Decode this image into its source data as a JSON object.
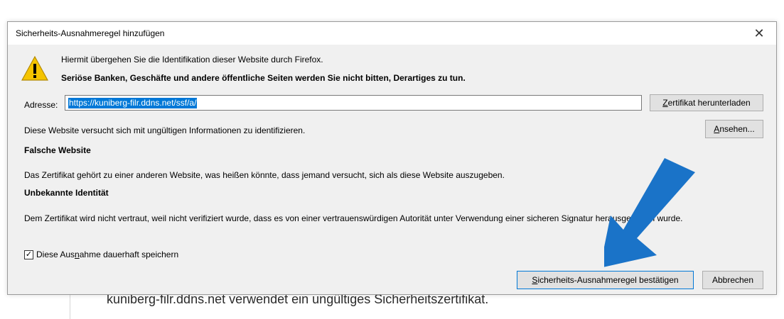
{
  "background": {
    "text": "kuniberg-filr.ddns.net verwendet ein ungültiges Sicherheitszertifikat."
  },
  "dialog": {
    "title": "Sicherheits-Ausnahmeregel hinzufügen",
    "close_glyph": "✕",
    "intro_line": "Hiermit übergehen Sie die Identifikation dieser Website durch Firefox.",
    "warning_line": "Seriöse Banken, Geschäfte und andere öffentliche Seiten werden Sie nicht bitten, Derartiges zu tun.",
    "address_label": "Adresse:",
    "address_value": "https://kuniberg-filr.ddns.net/ssf/a/",
    "download_cert_button": {
      "first": "Z",
      "rest": "ertifikat herunterladen"
    },
    "status_text": "Diese Website versucht sich mit ungültigen Informationen zu identifizieren.",
    "view_button": {
      "first": "A",
      "rest": "nsehen..."
    },
    "section1_title": "Falsche Website",
    "section1_text": "Das Zertifikat gehört zu einer anderen Website, was heißen könnte, dass jemand versucht, sich als diese Website auszugeben.",
    "section2_title": "Unbekannte Identität",
    "section2_text": "Dem Zertifikat wird nicht vertraut, weil nicht verifiziert wurde, dass es von einer vertrauenswürdigen Autorität unter Verwendung einer sicheren Signatur herausgegeben wurde.",
    "permanent_checkbox": {
      "checked": true,
      "check_glyph": "✓",
      "label_pre": "Diese Aus",
      "label_u": "n",
      "label_post": "ahme dauerhaft speichern"
    },
    "confirm_button": {
      "first": "S",
      "rest": "icherheits-Ausnahmeregel bestätigen"
    },
    "cancel_button": "Abbrechen"
  },
  "colors": {
    "dialog_bg": "#f0f0f0",
    "selection": "#0078d7",
    "arrow": "#1a73c8"
  },
  "icons": {
    "warning": "warning-triangle-icon",
    "annotation": "blue-arrow-annotation"
  }
}
